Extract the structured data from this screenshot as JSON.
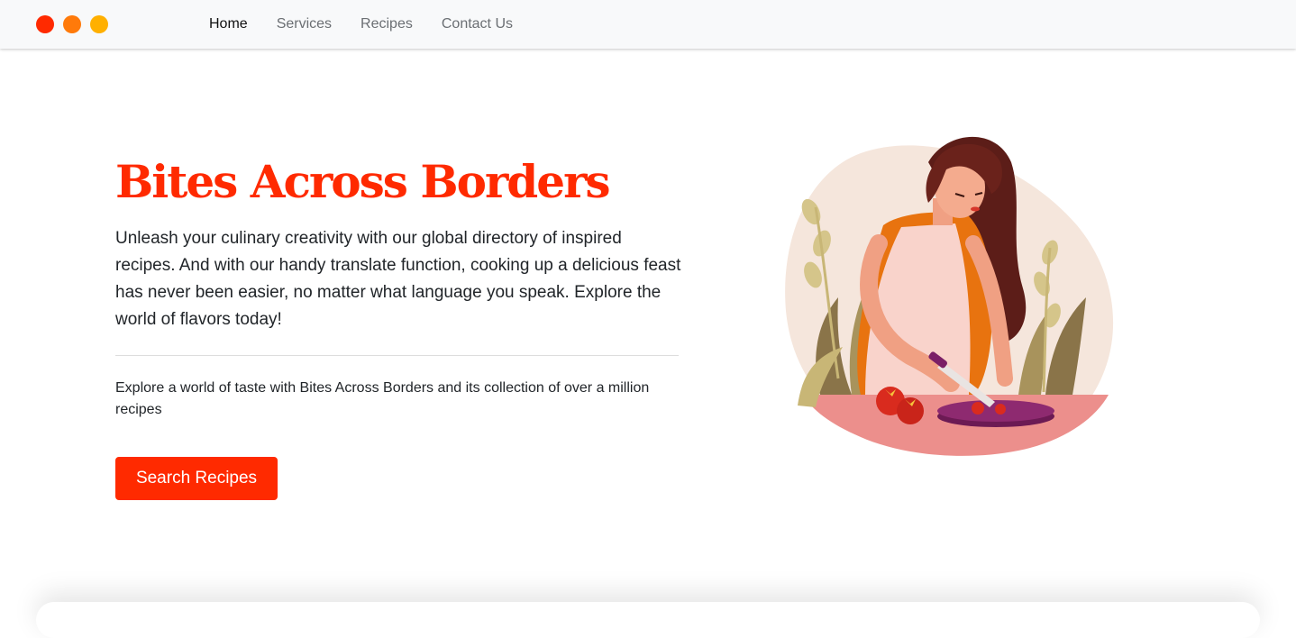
{
  "window": {
    "controls": [
      "close",
      "minimize",
      "maximize"
    ],
    "colors": {
      "close": "#ff2a00",
      "minimize": "#ff7a0a",
      "maximize": "#ffb000"
    }
  },
  "nav": {
    "items": [
      {
        "label": "Home",
        "active": true
      },
      {
        "label": "Services",
        "active": false
      },
      {
        "label": "Recipes",
        "active": false
      },
      {
        "label": "Contact Us",
        "active": false
      }
    ]
  },
  "hero": {
    "title": "Bites Across Borders",
    "lead": "Unleash your culinary creativity with our global directory of inspired recipes. And with our handy translate function, cooking up a delicious feast has never been easier, no matter what language you speak. Explore the world of flavors today!",
    "subtext": "Explore a world of taste with Bites Across Borders and its collection of over a million recipes",
    "cta_label": "Search Recipes"
  },
  "colors": {
    "accent": "#ff2a00",
    "navbar_bg": "#f8f9fa",
    "text": "#212529",
    "muted_nav": "#6b6f73"
  },
  "illustration": {
    "icon": "woman-chopping-tomatoes-illustration"
  }
}
